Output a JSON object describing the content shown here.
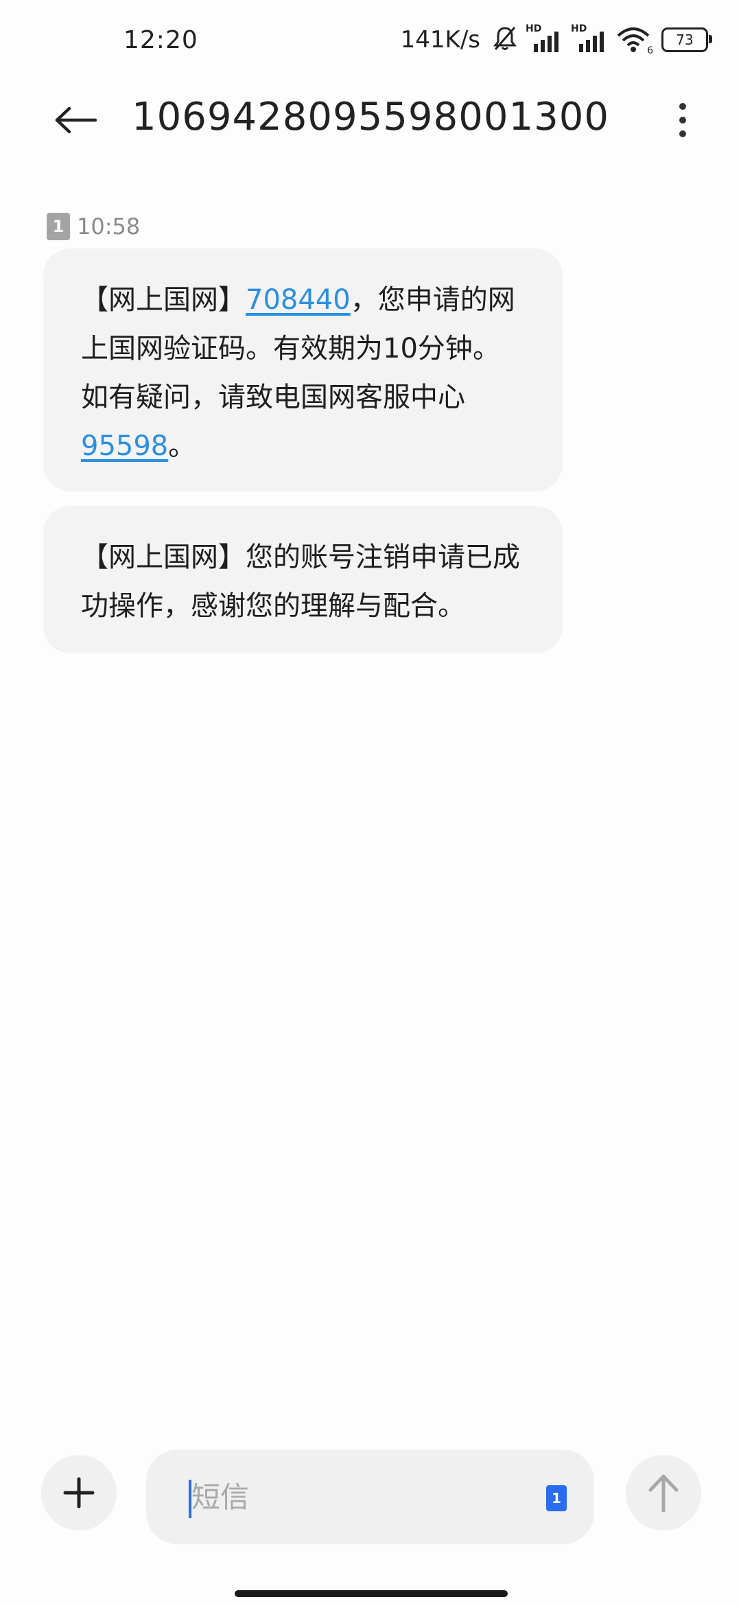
{
  "status_bar": {
    "time": "12:20",
    "net_speed": "141K/s",
    "signal_1_label": "HD",
    "signal_2_label": "HD",
    "wifi_sub": "6",
    "battery": "73",
    "icons": [
      "bell-muted-icon",
      "signal-icon",
      "signal-icon",
      "wifi-icon",
      "battery-icon"
    ]
  },
  "header": {
    "title": "1069428095598001300",
    "back_icon": "arrow-left-icon",
    "more_icon": "more-vertical-icon"
  },
  "messages": {
    "sim_label": "1",
    "time": "10:58",
    "items": [
      {
        "prefix": "【网上国网】",
        "code": "708440",
        "text_a": "，您申请的网上国网验证码。有效期为10分钟。如有疑问，请致电国网客服中心",
        "phone": "95598",
        "text_b": "。"
      },
      {
        "text": "【网上国网】您的账号注销申请已成功操作，感谢您的理解与配合。"
      }
    ]
  },
  "composer": {
    "placeholder": "短信",
    "sim_label": "1",
    "add_icon": "plus-icon",
    "send_icon": "arrow-up-icon"
  },
  "colors": {
    "link": "#2a8fe0",
    "bubble": "#f3f3f3",
    "accent": "#2a6cf0"
  }
}
